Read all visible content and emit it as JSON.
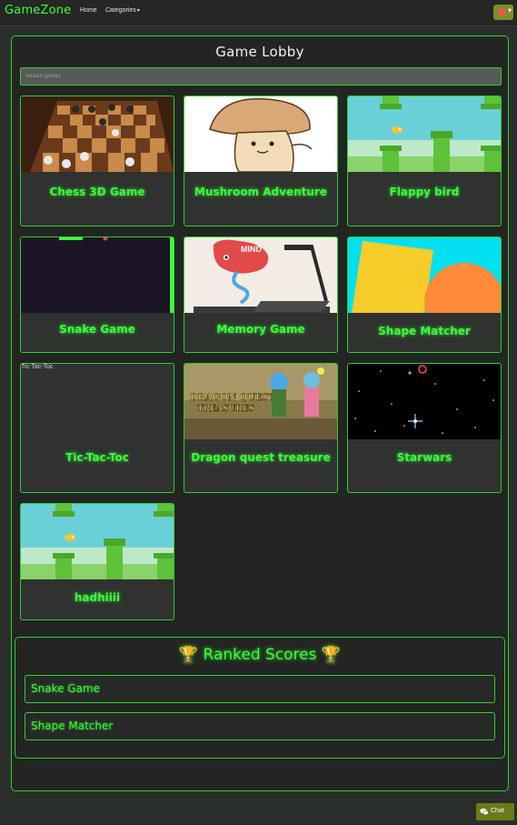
{
  "navbar": {
    "brand": "GameZone",
    "home": "Home",
    "categories": "Categories",
    "caret": "▾"
  },
  "lobby": {
    "title": "Game Lobby",
    "search_placeholder": "Search games"
  },
  "games": [
    {
      "title": "Chess 3D Game",
      "thumb": "chess"
    },
    {
      "title": "Mushroom Adventure",
      "thumb": "mushroom"
    },
    {
      "title": "Flappy bird",
      "thumb": "flappy"
    },
    {
      "title": "Snake Game",
      "thumb": "snake"
    },
    {
      "title": "Memory Game",
      "thumb": "memory"
    },
    {
      "title": "Shape Matcher",
      "thumb": "shapes"
    },
    {
      "title": "Tic-Tac-Toc",
      "thumb": "broken",
      "alt": "Tic-Tac-Toc"
    },
    {
      "title": "Dragon quest treasure",
      "thumb": "dragon"
    },
    {
      "title": "Starwars",
      "thumb": "stars"
    },
    {
      "title": "hadhiiii",
      "thumb": "flappy"
    }
  ],
  "ranked": {
    "trophy": "🏆",
    "title": "Ranked Scores",
    "items": [
      "Snake Game",
      "Shape Matcher"
    ]
  },
  "chat": {
    "label": "Chat",
    "icon": "chat-icon"
  },
  "colors": {
    "accent": "#3cff3c",
    "border": "#2fcf2f",
    "background": "#2a2e2a",
    "card": "#2f322f",
    "chat_button": "#6b7a18"
  }
}
